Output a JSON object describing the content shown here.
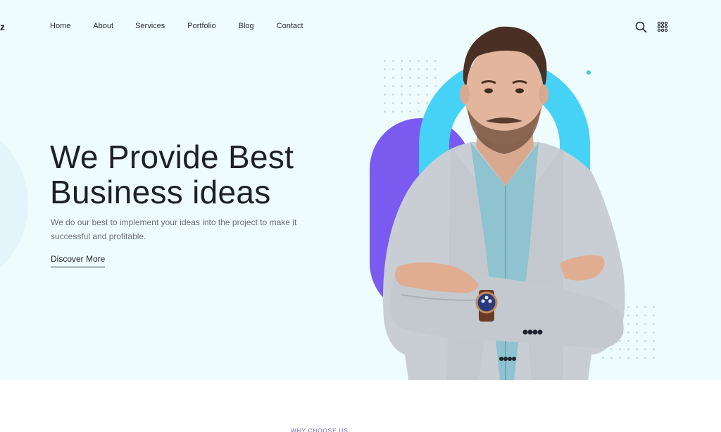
{
  "header": {
    "logo_fragment": "z",
    "nav": [
      {
        "label": "Home"
      },
      {
        "label": "About"
      },
      {
        "label": "Services"
      },
      {
        "label": "Portfolio"
      },
      {
        "label": "Blog"
      },
      {
        "label": "Contact"
      }
    ],
    "icons": [
      "search-icon",
      "grid-menu-icon"
    ]
  },
  "hero": {
    "title_line1": "We Provide Best",
    "title_line2": "Business ideas",
    "subtitle": "We do our best to implement your ideas into the project to make it successful and profitable.",
    "cta_label": "Discover More",
    "image_alt": "Businessman in grey blazer with crossed arms",
    "colors": {
      "background": "#effcfd",
      "accent_purple": "#7a5bf0",
      "accent_cyan": "#45d2f6",
      "heading": "#1d2125"
    }
  },
  "next_section": {
    "label": "WHY CHOOSE US"
  }
}
